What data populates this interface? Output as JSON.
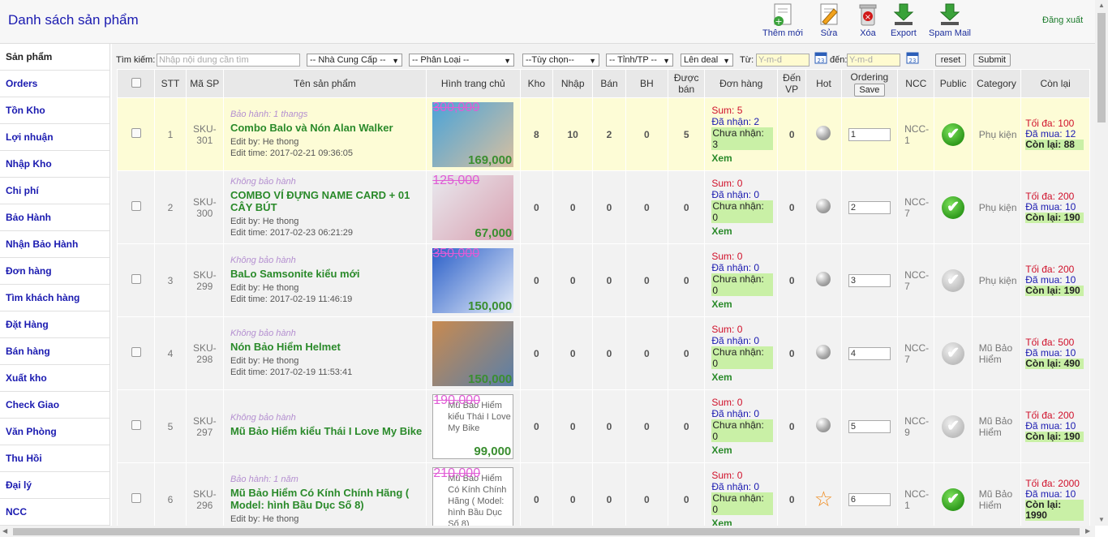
{
  "header": {
    "title": "Danh sách sản phẩm",
    "tools": [
      {
        "name": "add-new-button",
        "label": "Thêm mới"
      },
      {
        "name": "edit-button",
        "label": "Sửa"
      },
      {
        "name": "delete-button",
        "label": "Xóa"
      },
      {
        "name": "export-button",
        "label": "Export"
      },
      {
        "name": "spam-mail-button",
        "label": "Spam Mail"
      }
    ],
    "logout": "Đăng xuất"
  },
  "sidebar": {
    "items": [
      "Sản phẩm",
      "Orders",
      "Tồn Kho",
      "Lợi nhuận",
      "Nhập Kho",
      "Chi phí",
      "Bảo Hành",
      "Nhận Bảo Hành",
      "Đơn hàng",
      "Tìm khách hàng",
      "Đặt Hàng",
      "Bán hàng",
      "Xuất kho",
      "Check Giao",
      "Văn Phòng",
      "Thu Hồi",
      "Đại lý",
      "NCC"
    ]
  },
  "filters": {
    "search_label": "Tìm kiếm:",
    "search_placeholder": "Nhập nội dung cần tìm",
    "supplier": "-- Nhà Cung Cấp --",
    "category": "-- Phân Loại --",
    "option": "--Tùy chọn--",
    "province": "-- Tỉnh/TP --",
    "deal": "Lên deal",
    "from_label": "Từ:",
    "from_placeholder": "Y-m-d",
    "to_label": "đến:",
    "to_placeholder": "Y-m-d",
    "reset": "reset",
    "submit": "Submit"
  },
  "table": {
    "headers": {
      "stt": "STT",
      "sku": "Mã SP",
      "name": "Tên sản phẩm",
      "image": "Hình trang chủ",
      "kho": "Kho",
      "nhap": "Nhập",
      "ban": "Bán",
      "bh": "BH",
      "duoc_ban": "Được bán",
      "don_hang": "Đơn hàng",
      "den_vp": "Đến VP",
      "hot": "Hot",
      "ordering": "Ordering",
      "save": "Save",
      "ncc": "NCC",
      "public": "Public",
      "category": "Category",
      "con_lai": "Còn lại"
    },
    "labels": {
      "sum": "Sum:",
      "received": "Đã nhận:",
      "not_received": "Chưa nhận:",
      "view": "Xem",
      "max": "Tối đa:",
      "bought": "Đã mua:",
      "left": "Còn lại:",
      "edit_by": "Edit by:",
      "edit_time": "Edit time:"
    },
    "rows": [
      {
        "stt": "1",
        "sku": "SKU-301",
        "warranty": "Bảo hành: 1 thangs",
        "name": "Combo Balo và Nón Alan Walker",
        "edit_by": "He thong",
        "edit_time": "2017-02-21 09:36:05",
        "old_price": "300,000",
        "new_price": "169,000",
        "alt": "",
        "kho": "8",
        "nhap": "10",
        "ban": "2",
        "bh": "0",
        "duoc_ban": "5",
        "sum": "5",
        "received": "2",
        "not_received": "3",
        "den_vp": "0",
        "hot": "dot",
        "ordering": "1",
        "ncc": "NCC-1",
        "public": true,
        "category": "Phụ kiện",
        "max": "100",
        "bought": "12",
        "left": "88",
        "highlight": true,
        "img_colors": [
          "#4aa3d8",
          "#d8c0a0"
        ]
      },
      {
        "stt": "2",
        "sku": "SKU-300",
        "warranty": "Không bảo hành",
        "name": "COMBO VÍ ĐỰNG NAME CARD + 01 CÂY BÚT",
        "edit_by": "He thong",
        "edit_time": "2017-02-23 06:21:29",
        "old_price": "125,000",
        "new_price": "67,000",
        "alt": "",
        "kho": "0",
        "nhap": "0",
        "ban": "0",
        "bh": "0",
        "duoc_ban": "0",
        "sum": "0",
        "received": "0",
        "not_received": "0",
        "den_vp": "0",
        "hot": "dot",
        "ordering": "2",
        "ncc": "NCC-7",
        "public": true,
        "category": "Phụ kiện",
        "max": "200",
        "bought": "10",
        "left": "190",
        "highlight": false,
        "img_colors": [
          "#e8e8ee",
          "#d9a0b0"
        ]
      },
      {
        "stt": "3",
        "sku": "SKU-299",
        "warranty": "Không bảo hành",
        "name": "BaLo Samsonite kiểu mới",
        "edit_by": "He thong",
        "edit_time": "2017-02-19 11:46:19",
        "old_price": "350,000",
        "new_price": "150,000",
        "alt": "",
        "kho": "0",
        "nhap": "0",
        "ban": "0",
        "bh": "0",
        "duoc_ban": "0",
        "sum": "0",
        "received": "0",
        "not_received": "0",
        "den_vp": "0",
        "hot": "dot",
        "ordering": "3",
        "ncc": "NCC-7",
        "public": false,
        "category": "Phụ kiện",
        "max": "200",
        "bought": "10",
        "left": "190",
        "highlight": false,
        "img_colors": [
          "#2a5fc8",
          "#e8eefa"
        ]
      },
      {
        "stt": "4",
        "sku": "SKU-298",
        "warranty": "Không bảo hành",
        "name": "Nón Bảo Hiểm Helmet",
        "edit_by": "He thong",
        "edit_time": "2017-02-19 11:53:41",
        "old_price": "",
        "new_price": "150,000",
        "alt": "",
        "kho": "0",
        "nhap": "0",
        "ban": "0",
        "bh": "0",
        "duoc_ban": "0",
        "sum": "0",
        "received": "0",
        "not_received": "0",
        "den_vp": "0",
        "hot": "dot",
        "ordering": "4",
        "ncc": "NCC-7",
        "public": false,
        "category": "Mũ Bảo Hiểm",
        "max": "500",
        "bought": "10",
        "left": "490",
        "highlight": false,
        "img_colors": [
          "#c88a50",
          "#5a7fa8"
        ]
      },
      {
        "stt": "5",
        "sku": "SKU-297",
        "warranty": "Không bảo hành",
        "name": "Mũ Bảo Hiểm kiểu Thái I Love My Bike",
        "edit_by": "",
        "edit_time": "",
        "old_price": "190,000",
        "new_price": "99,000",
        "alt": "Mũ Bảo Hiểm kiểu Thái I Love My Bike",
        "kho": "0",
        "nhap": "0",
        "ban": "0",
        "bh": "0",
        "duoc_ban": "0",
        "sum": "0",
        "received": "0",
        "not_received": "0",
        "den_vp": "0",
        "hot": "dot",
        "ordering": "5",
        "ncc": "NCC-9",
        "public": false,
        "category": "Mũ Bảo Hiểm",
        "max": "200",
        "bought": "10",
        "left": "190",
        "highlight": false,
        "img_colors": [
          "#ffffff",
          "#ffffff"
        ]
      },
      {
        "stt": "6",
        "sku": "SKU-296",
        "warranty": "Bảo hành: 1 năm",
        "name": "Mũ Bảo Hiểm Có Kính Chính Hãng ( Model: hình Bầu Dục Số 8)",
        "edit_by": "He thong",
        "edit_time": "",
        "old_price": "210,000",
        "new_price": "",
        "alt": "Mũ Bảo Hiểm Có Kính Chính Hãng ( Model: hình Bầu Dục Số 8)",
        "kho": "0",
        "nhap": "0",
        "ban": "0",
        "bh": "0",
        "duoc_ban": "0",
        "sum": "0",
        "received": "0",
        "not_received": "0",
        "den_vp": "0",
        "hot": "star",
        "ordering": "6",
        "ncc": "NCC-1",
        "public": true,
        "category": "Mũ Bảo Hiểm",
        "max": "2000",
        "bought": "10",
        "left": "1990",
        "highlight": false,
        "img_colors": [
          "#ffffff",
          "#ffffff"
        ]
      }
    ]
  }
}
